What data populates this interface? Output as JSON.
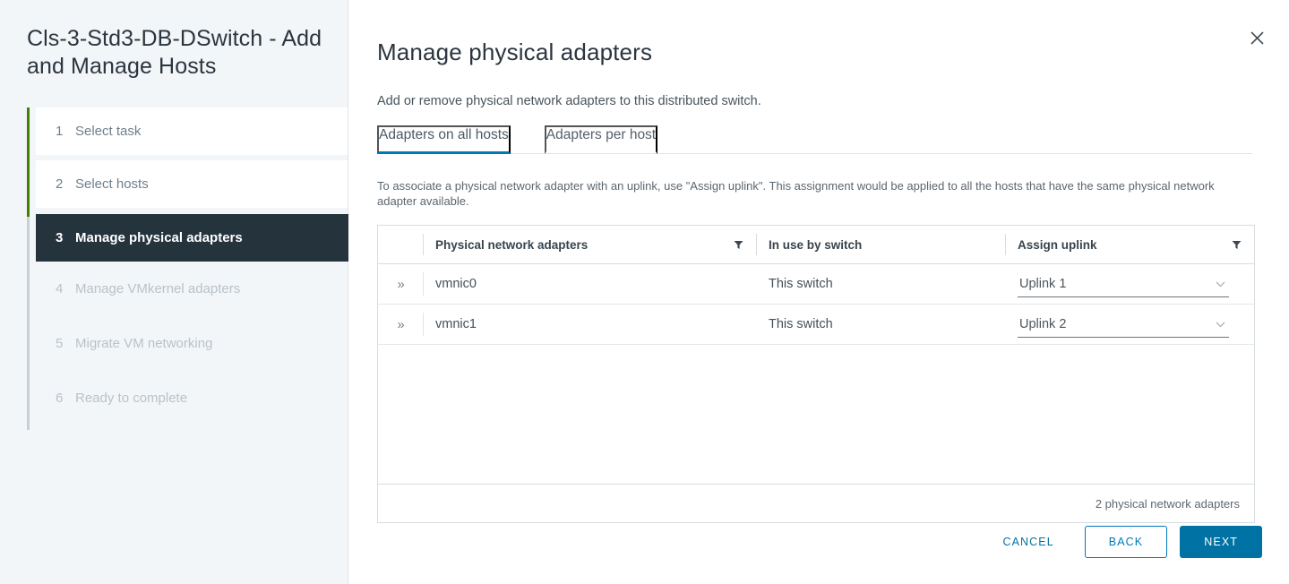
{
  "sidebar": {
    "title": "Cls-3-Std3-DB-DSwitch - Add and Manage Hosts",
    "accent_done_color": "#448000",
    "accent_active_color": "#25333d",
    "steps": [
      {
        "num": "1",
        "label": "Select task",
        "state": "done"
      },
      {
        "num": "2",
        "label": "Select hosts",
        "state": "done"
      },
      {
        "num": "3",
        "label": "Manage physical adapters",
        "state": "active"
      },
      {
        "num": "4",
        "label": "Manage VMkernel adapters",
        "state": "pending"
      },
      {
        "num": "5",
        "label": "Migrate VM networking",
        "state": "pending"
      },
      {
        "num": "6",
        "label": "Ready to complete",
        "state": "pending"
      }
    ]
  },
  "header": {
    "title": "Manage physical adapters",
    "subtitle": "Add or remove physical network adapters to this distributed switch.",
    "close_icon": "close-icon"
  },
  "tabs": [
    {
      "label": "Adapters on all hosts",
      "active": true
    },
    {
      "label": "Adapters per host",
      "active": false
    }
  ],
  "tab_accent_color": "#0079b8",
  "hint": "To associate a physical network adapter with an uplink, use \"Assign uplink\". This assignment would be applied to all the hosts that have the same physical network adapter available.",
  "table": {
    "columns": [
      {
        "key": "expand",
        "label": "",
        "filter": false
      },
      {
        "key": "name",
        "label": "Physical network adapters",
        "filter": true
      },
      {
        "key": "inuse",
        "label": "In use by switch",
        "filter": false
      },
      {
        "key": "uplink",
        "label": "Assign uplink",
        "filter": true
      }
    ],
    "rows": [
      {
        "expand_icon": "»",
        "name": "vmnic0",
        "inuse": "This switch",
        "uplink": "Uplink 1",
        "caret_icon": "⌄"
      },
      {
        "expand_icon": "»",
        "name": "vmnic1",
        "inuse": "This switch",
        "uplink": "Uplink 2",
        "caret_icon": "⌄"
      }
    ],
    "footer_count": "2 physical network adapters",
    "filter_icon": "filter-icon"
  },
  "actions": {
    "cancel": "CANCEL",
    "back": "BACK",
    "next": "NEXT",
    "primary_color": "#0072a3"
  }
}
